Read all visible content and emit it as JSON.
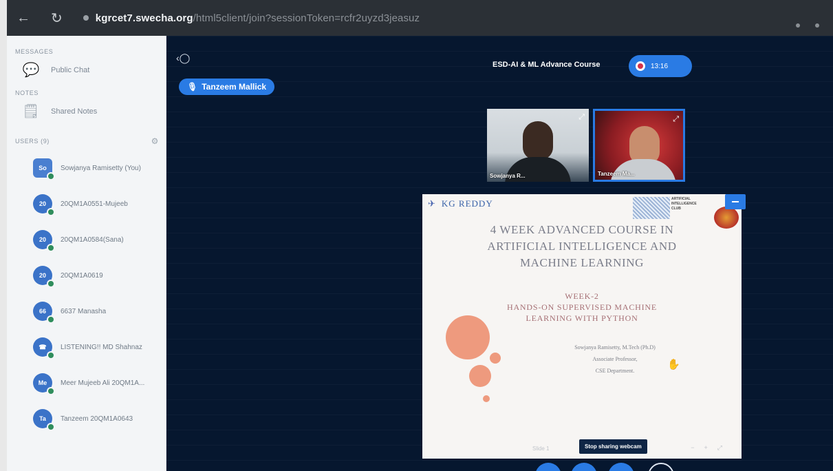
{
  "browser": {
    "back_icon": "back-arrow-icon",
    "reload_icon": "reload-icon",
    "url_host": "kgrcet7.swecha.org",
    "url_path": "/html5client/join?sessionToken=rcfr2uyzd3jeasuz"
  },
  "sidebar": {
    "messages_title": "MESSAGES",
    "public_chat": "Public Chat",
    "notes_title": "NOTES",
    "shared_notes": "Shared Notes",
    "users_title": "USERS (9)",
    "users": [
      {
        "initials": "So",
        "name": "Sowjanya Ramisetty (You)",
        "color": "#4a7fd0",
        "shape": "square"
      },
      {
        "initials": "20",
        "name": "20QM1A0551-Mujeeb",
        "color": "#3b73c8",
        "shape": "round"
      },
      {
        "initials": "20",
        "name": "20QM1A0584(Sana)",
        "color": "#3b73c8",
        "shape": "round"
      },
      {
        "initials": "20",
        "name": "20QM1A0619",
        "color": "#3b73c8",
        "shape": "round"
      },
      {
        "initials": "66",
        "name": "6637 Manasha",
        "color": "#3b73c8",
        "shape": "round"
      },
      {
        "initials": "",
        "name": "LISTENING!! MD Shahnaz",
        "color": "#3b73c8",
        "shape": "round"
      },
      {
        "initials": "Me",
        "name": "Meer Mujeeb Ali 20QM1A...",
        "color": "#3b73c8",
        "shape": "round"
      },
      {
        "initials": "Ta",
        "name": "Tanzeem 20QM1A0643",
        "color": "#3b73c8",
        "shape": "round"
      }
    ]
  },
  "top": {
    "talker": "Tanzeem Mallick",
    "meeting_title": "ESD-AI & ML Advance Course",
    "timer": "13:16"
  },
  "webcams": [
    {
      "name": "Sowjanya R..."
    },
    {
      "name": "Tanzeem Ma..."
    }
  ],
  "slide": {
    "logo": "KG REDDY",
    "club_text": "ARTIFICIAL INTELLIGENCE CLUB",
    "title_line1": "4 WEEK ADVANCED COURSE IN",
    "title_line2": "ARTIFICIAL INTELLIGENCE AND",
    "title_line3": "MACHINE LEARNING",
    "week": "WEEK-2",
    "topic_line1": "HANDS-ON SUPERVISED MACHINE",
    "topic_line2": "LEARNING WITH PYTHON",
    "presenter": "Sowjanya Ramisetty, M.Tech (Ph.D)",
    "designation": "Associate Professor,",
    "department": "CSE Department.",
    "slide_nav": "Slide 1"
  },
  "stop_webcam": "Stop sharing webcam",
  "colors": {
    "accent": "#2a7be4",
    "app_bg": "#06172f",
    "sidebar_bg": "#f3f5f7"
  }
}
